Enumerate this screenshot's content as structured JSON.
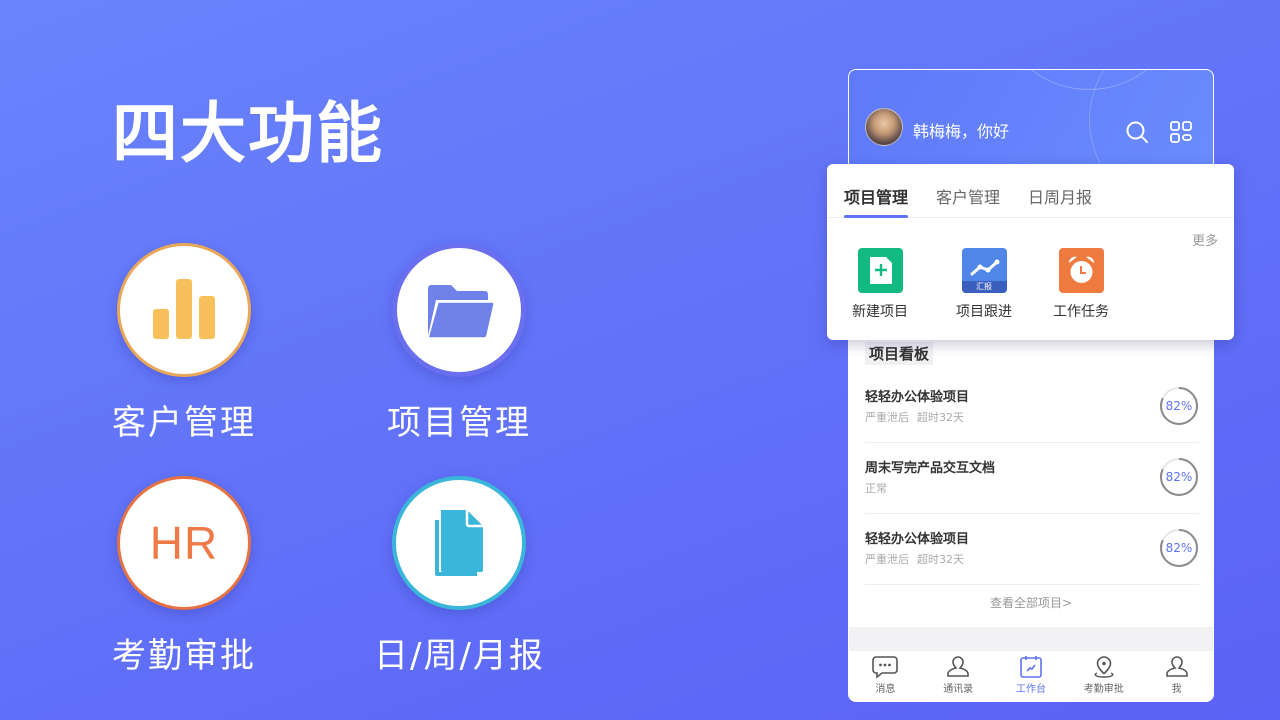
{
  "page": {
    "title": "四大功能",
    "features": [
      {
        "label": "客户管理",
        "icon": "bar-chart-icon",
        "color": "#f7c05a"
      },
      {
        "label": "项目管理",
        "icon": "folder-icon",
        "color": "#6f82ea"
      },
      {
        "label": "考勤审批",
        "icon": "hr-icon",
        "icon_text": "HR",
        "color": "#ee7a48"
      },
      {
        "label": "日/周/月报",
        "icon": "document-icon",
        "color": "#3ab6da"
      }
    ]
  },
  "phone": {
    "header": {
      "greeting": "韩梅梅，你好",
      "icons": [
        "search-icon",
        "grid-icon"
      ]
    },
    "tabs": [
      {
        "label": "项目管理",
        "active": true
      },
      {
        "label": "客户管理",
        "active": false
      },
      {
        "label": "日周月报",
        "active": false
      }
    ],
    "more_label": "更多",
    "quick_actions": [
      {
        "label": "新建项目",
        "icon": "new-file-icon"
      },
      {
        "label": "项目跟进",
        "icon": "report-trend-icon",
        "band_text": "汇报"
      },
      {
        "label": "工作任务",
        "icon": "alarm-clock-icon"
      }
    ],
    "board": {
      "title": "项目看板",
      "projects": [
        {
          "name": "轻轻办公体验项目",
          "status": "严重泄后",
          "overdue": "超时32天",
          "progress": 82,
          "progress_label": "82%"
        },
        {
          "name": "周末写完产品交互文档",
          "status": "正常",
          "overdue": "",
          "progress": 82,
          "progress_label": "82%"
        },
        {
          "name": "轻轻办公体验项目",
          "status": "严重泄后",
          "overdue": "超时32天",
          "progress": 82,
          "progress_label": "82%"
        }
      ],
      "view_all": "查看全部项目>"
    },
    "tabbar": [
      {
        "label": "消息",
        "icon": "message-icon",
        "active": false
      },
      {
        "label": "通讯录",
        "icon": "contacts-icon",
        "active": false
      },
      {
        "label": "工作台",
        "icon": "workbench-icon",
        "active": true
      },
      {
        "label": "考勤审批",
        "icon": "location-icon",
        "active": false
      },
      {
        "label": "我",
        "icon": "profile-icon",
        "active": false
      }
    ]
  },
  "colors": {
    "accent": "#5f73f4",
    "background_start": "#6a84fc",
    "background_end": "#5b62f5"
  }
}
